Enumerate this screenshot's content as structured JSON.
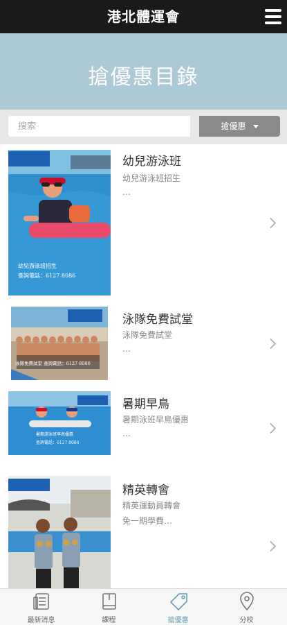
{
  "header": {
    "title": "港北體運會",
    "menu_icon": "hamburger-menu-icon"
  },
  "banner": {
    "title": "搶優惠目錄"
  },
  "search": {
    "placeholder": "搜索",
    "filter_label": "搶優惠"
  },
  "items": [
    {
      "title": "幼兒游泳班",
      "subtitle": "幼兒游泳班招生",
      "more": "…",
      "photo_caption_1": "幼兒游泳班招生",
      "photo_caption_2": "查詢電話：6127 8086"
    },
    {
      "title": "泳隊免費試堂",
      "subtitle": "泳隊免費試堂",
      "more": "…",
      "photo_caption_1": "泳隊免費試堂 查詢電話：6127 8086"
    },
    {
      "title": "暑期早鳥",
      "subtitle": "暑期泳班早鳥優惠",
      "more": "…",
      "photo_caption_1": "暑期游泳班早鳥優惠",
      "photo_caption_2": "查詢電話：6127 8086"
    },
    {
      "title": "精英轉會",
      "subtitle": "精英運動員轉會",
      "more": "免一期學費…"
    }
  ],
  "tabs": [
    {
      "label": "最新消息",
      "icon": "newspaper-icon"
    },
    {
      "label": "課程",
      "icon": "book-icon"
    },
    {
      "label": "搶優惠",
      "icon": "tag-icon",
      "active": true
    },
    {
      "label": "分校",
      "icon": "location-pin-icon"
    }
  ],
  "colors": {
    "topbar": "#1a1a1a",
    "banner": "#acc9d6",
    "active_tab": "#6a9bb5",
    "filter_button": "#8a8a8a"
  }
}
